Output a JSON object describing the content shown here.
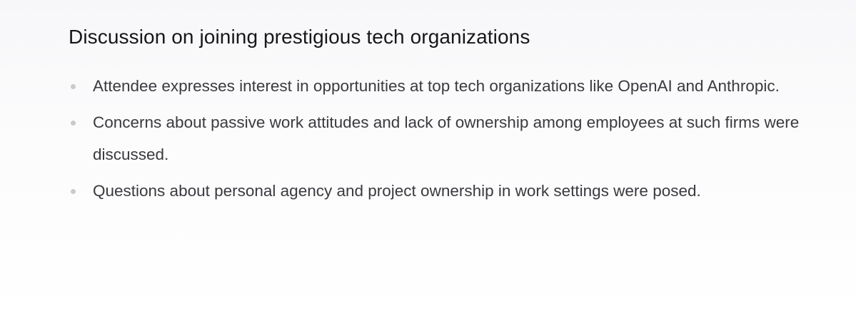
{
  "section": {
    "title": "Discussion on joining prestigious tech organizations",
    "bullets": [
      "Attendee expresses interest in opportunities at top tech organizations like OpenAI and Anthropic.",
      "Concerns about passive work attitudes and lack of ownership among employees at such firms were discussed.",
      "Questions about personal agency and project ownership in work settings were posed."
    ]
  }
}
